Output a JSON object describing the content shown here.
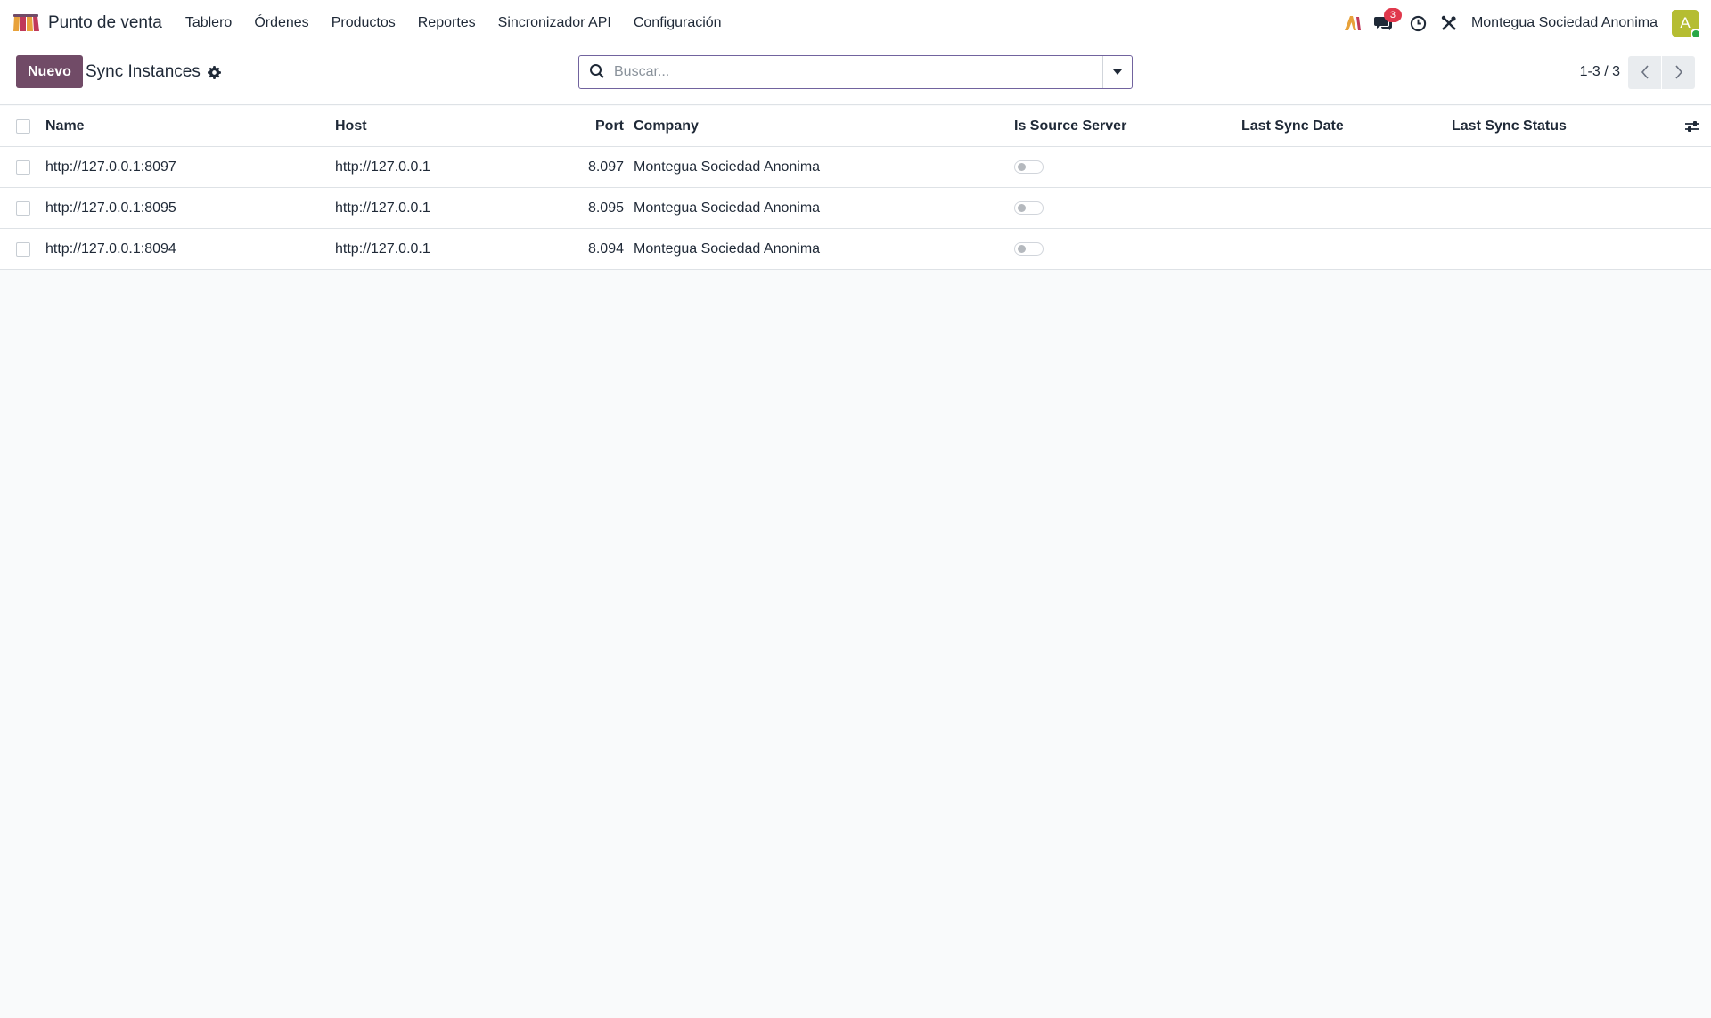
{
  "navbar": {
    "app_name": "Punto de venta",
    "menu": [
      "Tablero",
      "Órdenes",
      "Productos",
      "Reportes",
      "Sincronizador API",
      "Configuración"
    ],
    "chat_badge": "3",
    "company": "Montegua Sociedad Anonima",
    "avatar_letter": "A"
  },
  "control_panel": {
    "new_label": "Nuevo",
    "title": "Sync Instances",
    "search_placeholder": "Buscar...",
    "pager": "1-3 / 3"
  },
  "table": {
    "columns": {
      "name": "Name",
      "host": "Host",
      "port": "Port",
      "company": "Company",
      "is_source": "Is Source Server",
      "last_sync_date": "Last Sync Date",
      "last_sync_status": "Last Sync Status"
    },
    "rows": [
      {
        "name": "http://127.0.0.1:8097",
        "host": "http://127.0.0.1",
        "port": "8.097",
        "company": "Montegua Sociedad Anonima",
        "is_source": false,
        "last_sync_date": "",
        "last_sync_status": ""
      },
      {
        "name": "http://127.0.0.1:8095",
        "host": "http://127.0.0.1",
        "port": "8.095",
        "company": "Montegua Sociedad Anonima",
        "is_source": false,
        "last_sync_date": "",
        "last_sync_status": ""
      },
      {
        "name": "http://127.0.0.1:8094",
        "host": "http://127.0.0.1",
        "port": "8.094",
        "company": "Montegua Sociedad Anonima",
        "is_source": false,
        "last_sync_date": "",
        "last_sync_status": ""
      }
    ]
  },
  "colors": {
    "brand": "#714b67",
    "badge": "#e0384c",
    "avatar": "#b5bd32"
  }
}
